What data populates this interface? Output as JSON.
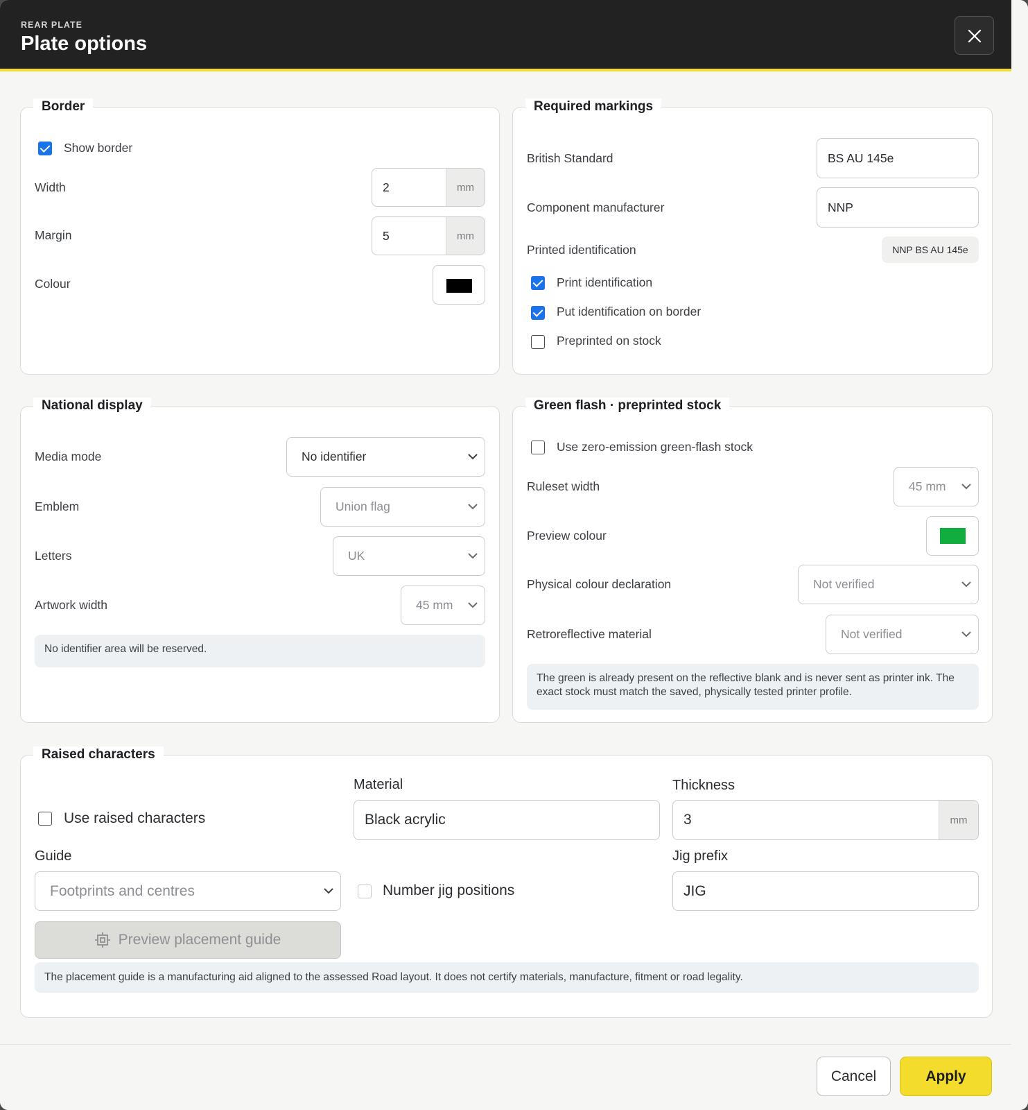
{
  "header": {
    "eyebrow": "REAR PLATE",
    "title": "Plate options"
  },
  "border": {
    "legend": "Border",
    "show_border_label": "Show border",
    "show_border": true,
    "width_label": "Width",
    "width_value": "2",
    "width_unit": "mm",
    "margin_label": "Margin",
    "margin_value": "5",
    "margin_unit": "mm",
    "colour_label": "Colour",
    "colour": "#000000"
  },
  "markings": {
    "legend": "Required markings",
    "british_standard_label": "British Standard",
    "british_standard_value": "BS AU 145e",
    "manufacturer_label": "Component manufacturer",
    "manufacturer_value": "NNP",
    "printed_id_label": "Printed identification",
    "printed_id_value": "NNP BS AU 145e",
    "print_id_label": "Print identification",
    "print_id": true,
    "on_border_label": "Put identification on border",
    "on_border": true,
    "preprinted_label": "Preprinted on stock",
    "preprinted": false
  },
  "national": {
    "legend": "National display",
    "media_mode_label": "Media mode",
    "media_mode_value": "No identifier",
    "emblem_label": "Emblem",
    "emblem_value": "Union flag",
    "letters_label": "Letters",
    "letters_value": "UK",
    "artwork_label": "Artwork width",
    "artwork_value": "45 mm",
    "note": "No identifier area will be reserved."
  },
  "green": {
    "legend": "Green flash · preprinted stock",
    "use_label": "Use zero-emission green-flash stock",
    "use": false,
    "ruleset_label": "Ruleset width",
    "ruleset_value": "45 mm",
    "preview_label": "Preview colour",
    "preview_colour": "#12ad3f",
    "physical_label": "Physical colour declaration",
    "physical_value": "Not verified",
    "retro_label": "Retroreflective material",
    "retro_value": "Not verified",
    "note": "The green is already present on the reflective blank and is never sent as printer ink. The exact stock must match the saved, physically tested printer profile."
  },
  "raised": {
    "legend": "Raised characters",
    "use_label": "Use raised characters",
    "use": false,
    "material_label": "Material",
    "material_value": "Black acrylic",
    "thickness_label": "Thickness",
    "thickness_value": "3",
    "thickness_unit": "mm",
    "guide_label": "Guide",
    "guide_value": "Footprints and centres",
    "number_jig_label": "Number jig positions",
    "jig_prefix_label": "Jig prefix",
    "jig_prefix_value": "JIG",
    "preview_button": "Preview placement guide",
    "note": "The placement guide is a manufacturing aid aligned to the assessed Road layout. It does not certify materials, manufacture, fitment or road legality."
  },
  "footer": {
    "cancel": "Cancel",
    "apply": "Apply"
  },
  "colors": {
    "accent": "#f3dc2b",
    "checkbox": "#1a73e8",
    "header_bg": "#222222"
  },
  "icons": {
    "close": "close-icon",
    "chevron": "chevron-down-icon",
    "guide": "placement-guide-icon"
  }
}
